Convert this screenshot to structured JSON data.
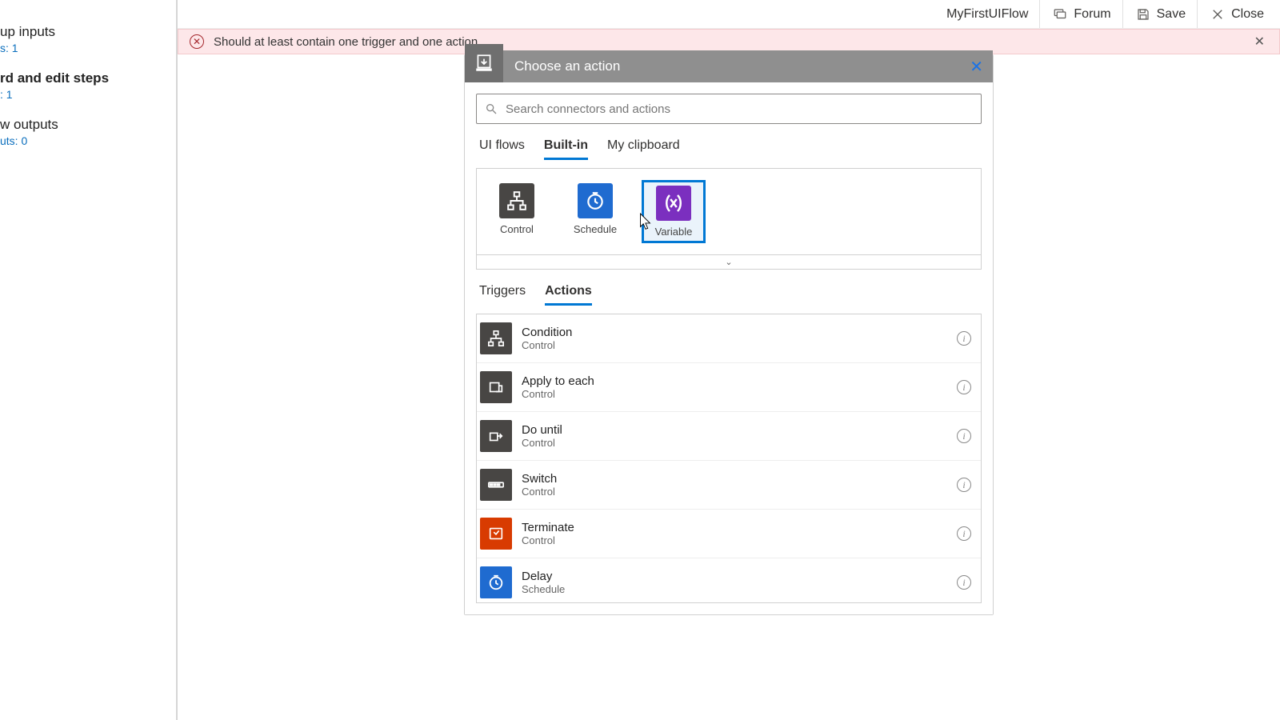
{
  "header": {
    "flowName": "MyFirstUIFlow",
    "forum": "Forum",
    "save": "Save",
    "close": "Close"
  },
  "error": {
    "message": "Should at least contain one trigger and one action"
  },
  "leftPanel": {
    "items": [
      {
        "title": "up inputs",
        "sub": "s: 1",
        "bold": false
      },
      {
        "title": "rd and edit steps",
        "sub": ": 1",
        "bold": true
      },
      {
        "title": "w outputs",
        "sub": "uts: 0",
        "bold": false
      }
    ]
  },
  "panel": {
    "title": "Choose an action",
    "searchPlaceholder": "Search connectors and actions",
    "connectorTabs": {
      "uiflows": "UI flows",
      "builtin": "Built-in",
      "clipboard": "My clipboard"
    },
    "connectors": [
      {
        "label": "Control"
      },
      {
        "label": "Schedule"
      },
      {
        "label": "Variable"
      }
    ],
    "lowerTabs": {
      "triggers": "Triggers",
      "actions": "Actions"
    },
    "actions": [
      {
        "name": "Condition",
        "sub": "Control",
        "iconClass": "ai-control",
        "svg": "condition"
      },
      {
        "name": "Apply to each",
        "sub": "Control",
        "iconClass": "ai-control",
        "svg": "apply"
      },
      {
        "name": "Do until",
        "sub": "Control",
        "iconClass": "ai-control",
        "svg": "dountil"
      },
      {
        "name": "Switch",
        "sub": "Control",
        "iconClass": "ai-control",
        "svg": "switch"
      },
      {
        "name": "Terminate",
        "sub": "Control",
        "iconClass": "ai-terminate",
        "svg": "terminate"
      },
      {
        "name": "Delay",
        "sub": "Schedule",
        "iconClass": "ai-schedule",
        "svg": "delay"
      }
    ]
  }
}
